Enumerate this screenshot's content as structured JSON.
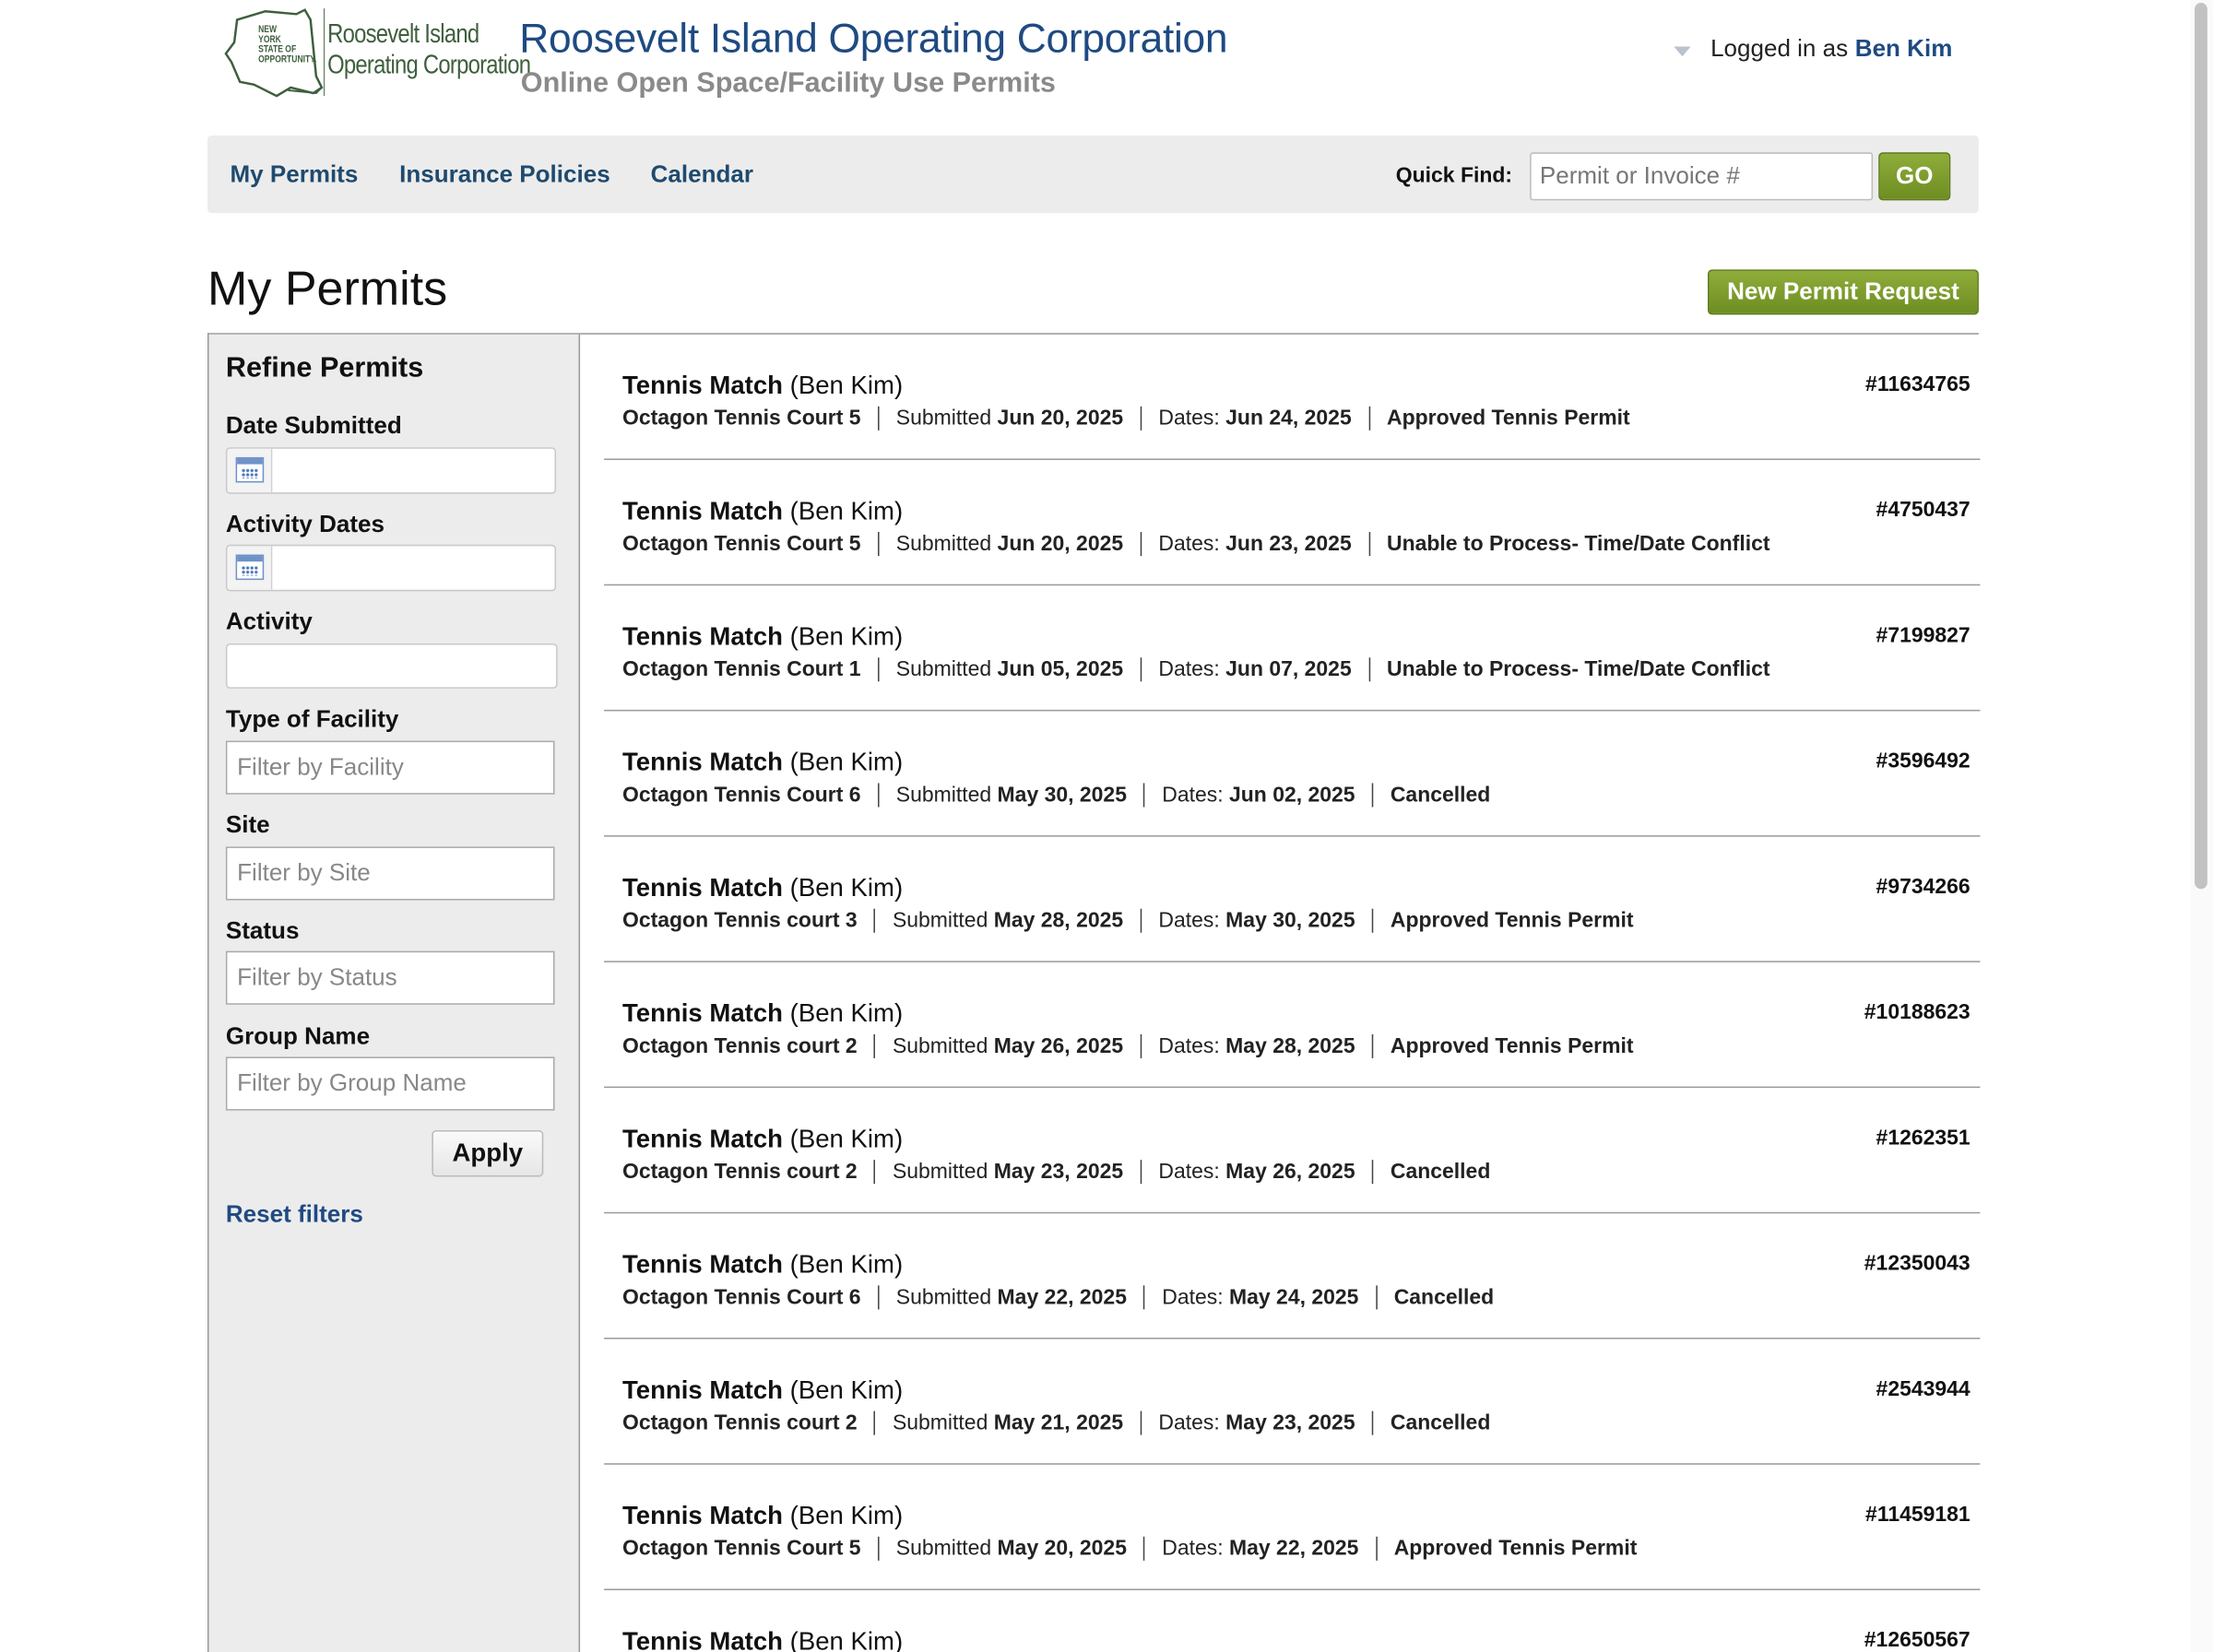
{
  "header": {
    "logo_line1": "Roosevelt Island",
    "logo_line2": "Operating Corporation",
    "logo_state": "NEW YORK STATE OF OPPORTUNITY.",
    "org_title": "Roosevelt Island Operating Corporation",
    "org_subtitle": "Online Open Space/Facility Use Permits",
    "logged_in_prefix": "Logged in as",
    "user_name": "Ben Kim"
  },
  "nav": {
    "items": [
      "My Permits",
      "Insurance Policies",
      "Calendar"
    ],
    "quick_find_label": "Quick Find:",
    "quick_find_placeholder": "Permit or Invoice #",
    "go_label": "GO"
  },
  "page": {
    "title": "My Permits",
    "new_request_label": "New Permit Request"
  },
  "sidebar": {
    "title": "Refine Permits",
    "date_submitted_label": "Date Submitted",
    "activity_dates_label": "Activity Dates",
    "activity_label": "Activity",
    "type_of_facility_label": "Type of Facility",
    "type_of_facility_placeholder": "Filter by Facility",
    "site_label": "Site",
    "site_placeholder": "Filter by Site",
    "status_label": "Status",
    "status_placeholder": "Filter by Status",
    "group_name_label": "Group Name",
    "group_name_placeholder": "Filter by Group Name",
    "apply_label": "Apply",
    "reset_label": "Reset filters"
  },
  "permits": [
    {
      "activity": "Tennis Match",
      "person": "(Ben Kim)",
      "number": "#11634765",
      "site": "Octagon Tennis Court 5",
      "submitted_label": "Submitted",
      "submitted": "Jun 20, 2025",
      "dates_label": "Dates:",
      "dates": "Jun 24, 2025",
      "status": "Approved Tennis Permit"
    },
    {
      "activity": "Tennis Match",
      "person": "(Ben Kim)",
      "number": "#4750437",
      "site": "Octagon Tennis Court 5",
      "submitted_label": "Submitted",
      "submitted": "Jun 20, 2025",
      "dates_label": "Dates:",
      "dates": "Jun 23, 2025",
      "status": "Unable to Process- Time/Date Conflict"
    },
    {
      "activity": "Tennis Match",
      "person": "(Ben Kim)",
      "number": "#7199827",
      "site": "Octagon Tennis Court 1",
      "submitted_label": "Submitted",
      "submitted": "Jun 05, 2025",
      "dates_label": "Dates:",
      "dates": "Jun 07, 2025",
      "status": "Unable to Process- Time/Date Conflict"
    },
    {
      "activity": "Tennis Match",
      "person": "(Ben Kim)",
      "number": "#3596492",
      "site": "Octagon Tennis Court 6",
      "submitted_label": "Submitted",
      "submitted": "May 30, 2025",
      "dates_label": "Dates:",
      "dates": "Jun 02, 2025",
      "status": "Cancelled"
    },
    {
      "activity": "Tennis Match",
      "person": "(Ben Kim)",
      "number": "#9734266",
      "site": "Octagon Tennis court 3",
      "submitted_label": "Submitted",
      "submitted": "May 28, 2025",
      "dates_label": "Dates:",
      "dates": "May 30, 2025",
      "status": "Approved Tennis Permit"
    },
    {
      "activity": "Tennis Match",
      "person": "(Ben Kim)",
      "number": "#10188623",
      "site": "Octagon Tennis court 2",
      "submitted_label": "Submitted",
      "submitted": "May 26, 2025",
      "dates_label": "Dates:",
      "dates": "May 28, 2025",
      "status": "Approved Tennis Permit"
    },
    {
      "activity": "Tennis Match",
      "person": "(Ben Kim)",
      "number": "#1262351",
      "site": "Octagon Tennis court 2",
      "submitted_label": "Submitted",
      "submitted": "May 23, 2025",
      "dates_label": "Dates:",
      "dates": "May 26, 2025",
      "status": "Cancelled"
    },
    {
      "activity": "Tennis Match",
      "person": "(Ben Kim)",
      "number": "#12350043",
      "site": "Octagon Tennis Court 6",
      "submitted_label": "Submitted",
      "submitted": "May 22, 2025",
      "dates_label": "Dates:",
      "dates": "May 24, 2025",
      "status": "Cancelled"
    },
    {
      "activity": "Tennis Match",
      "person": "(Ben Kim)",
      "number": "#2543944",
      "site": "Octagon Tennis court 2",
      "submitted_label": "Submitted",
      "submitted": "May 21, 2025",
      "dates_label": "Dates:",
      "dates": "May 23, 2025",
      "status": "Cancelled"
    },
    {
      "activity": "Tennis Match",
      "person": "(Ben Kim)",
      "number": "#11459181",
      "site": "Octagon Tennis Court 5",
      "submitted_label": "Submitted",
      "submitted": "May 20, 2025",
      "dates_label": "Dates:",
      "dates": "May 22, 2025",
      "status": "Approved Tennis Permit"
    },
    {
      "activity": "Tennis Match",
      "person": "(Ben Kim)",
      "number": "#12650567",
      "site": "",
      "submitted_label": "",
      "submitted": "",
      "dates_label": "",
      "dates": "",
      "status": ""
    }
  ],
  "colors": {
    "brand_blue": "#1f4a82",
    "button_green": "#7b9a2c",
    "nav_bg": "#ececec"
  }
}
